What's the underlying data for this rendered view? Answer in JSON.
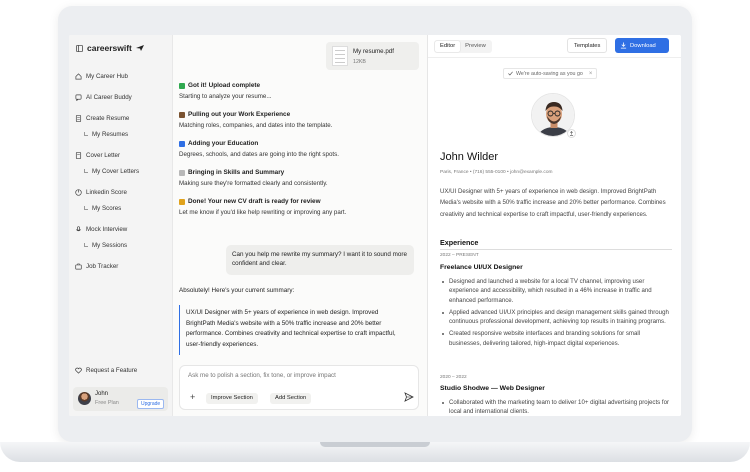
{
  "sidebar": {
    "brand": "careerswift",
    "nav": [
      {
        "label": "My Career Hub",
        "icon": "home-icon",
        "sub": false
      },
      {
        "label": "AI Career Buddy",
        "icon": "chat-icon",
        "sub": false
      },
      {
        "label": "Create Resume",
        "icon": "document-icon",
        "sub": false
      },
      {
        "label": "My Resumes",
        "icon": "",
        "sub": true
      },
      {
        "label": "Cover Letter",
        "icon": "document-icon",
        "sub": false
      },
      {
        "label": "My Cover Letters",
        "icon": "",
        "sub": true
      },
      {
        "label": "Linkedin Score",
        "icon": "chart-icon",
        "sub": false
      },
      {
        "label": "My Scores",
        "icon": "",
        "sub": true
      },
      {
        "label": "Mock Interview",
        "icon": "microphone-icon",
        "sub": false
      },
      {
        "label": "My Sessions",
        "icon": "",
        "sub": true
      },
      {
        "label": "Job Tracker",
        "icon": "briefcase-icon",
        "sub": false
      }
    ],
    "request_feature": "Request a Feature",
    "user": {
      "name": "John",
      "plan": "Free Plan",
      "upgrade": "Upgrade"
    }
  },
  "chat": {
    "file": {
      "name": "My resume.pdf",
      "size": "12KB"
    },
    "steps": [
      {
        "title": "Got it! Upload complete",
        "desc": "Starting to analyze your resume...",
        "color": "#2fa84f"
      },
      {
        "title": "Pulling out your Work Experience",
        "desc": "Matching roles, companies, and dates into the template.",
        "color": "#7a5230"
      },
      {
        "title": "Adding your Education",
        "desc": "Degrees, schools, and dates are going into the right spots.",
        "color": "#2f6fe4"
      },
      {
        "title": "Bringing in Skills and Summary",
        "desc": "Making sure they're formatted clearly and consistently.",
        "color": "#9a9a9a"
      },
      {
        "title": "Done! Your new CV draft is ready for review",
        "desc": "Let me know if you'd like help rewriting or improving any part.",
        "color": "#e0a21c"
      }
    ],
    "user_message": "Can you help me rewrite my summary? I want it to sound more confident and clear.",
    "reply_intro": "Absolutely! Here's your current summary:",
    "quoted_summary": "UX/UI Designer with 5+ years of experience in web design. Improved BrightPath Media's website with a 50% traffic increase and 20% better performance. Combines creativity and technical expertise to craft impactful, user-friendly experiences.",
    "composer": {
      "placeholder": "Ask me to polish a section, fix tone, or improve impact",
      "chips": [
        "Improve Section",
        "Add Section"
      ]
    }
  },
  "editor": {
    "tabs": [
      "Editor",
      "Preview"
    ],
    "active_tab": "Editor",
    "templates_label": "Templates",
    "download_label": "Download",
    "autosave": "We're auto-saving as you go",
    "resume": {
      "name": "John Wilder",
      "contact": "Paris, France • (716) 555-0100 • john@example.com",
      "summary": "UX/UI Designer with 5+ years of experience in web design. Improved BrightPath Media's website with a 50% traffic increase and 20% better performance. Combines creativity and technical expertise to craft impactful, user-friendly experiences.",
      "experience_title": "Experience",
      "jobs": [
        {
          "dates": "2022 – PRESENT",
          "title": "Freelance UI/UX Designer",
          "bullets": [
            "Designed and launched a website for a local TV channel, improving user experience and accessibility, which resulted in a 46% increase in traffic and enhanced performance.",
            "Applied advanced UI/UX principles and design management skills gained through continuous professional development, achieving top results in training programs.",
            "Created responsive website interfaces and branding solutions for small businesses, delivering tailored, high-impact digital experiences."
          ]
        },
        {
          "dates": "2020 – 2022",
          "title": "Studio Shodwe — Web Designer",
          "bullets": [
            "Collaborated with the marketing team to deliver 10+ digital advertising projects for local and international clients."
          ]
        }
      ]
    }
  }
}
